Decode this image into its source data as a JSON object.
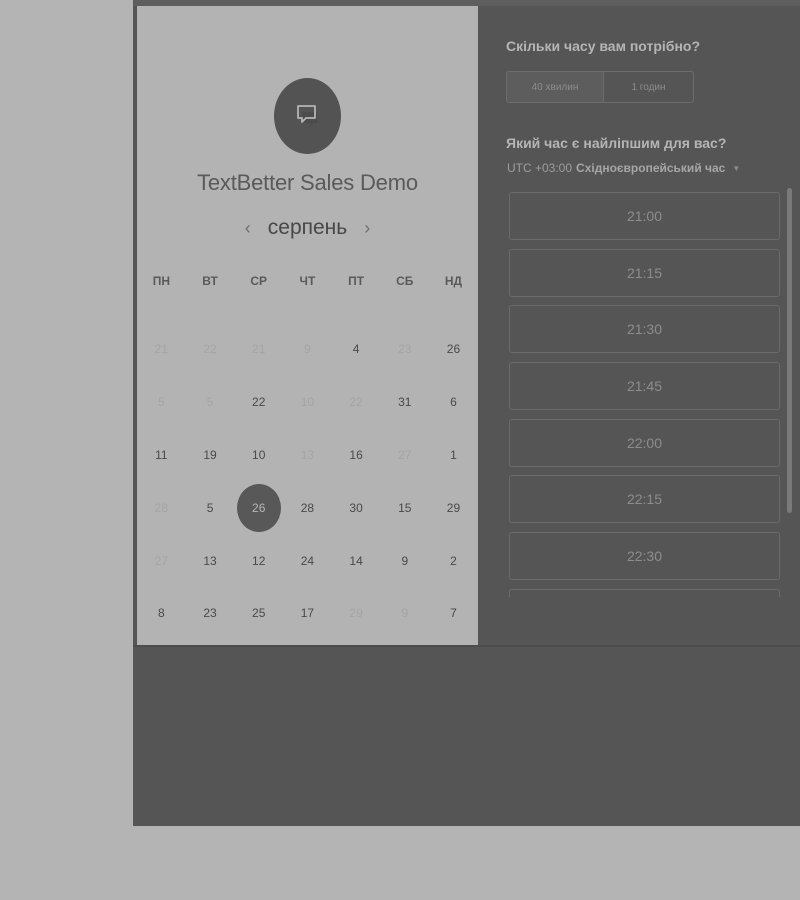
{
  "calendar": {
    "title": "TextBetter Sales Demo",
    "month": "серпень",
    "weekdays": [
      "ПН",
      "ВТ",
      "СР",
      "ЧТ",
      "ПТ",
      "СБ",
      "НД"
    ],
    "days": [
      {
        "label": "21",
        "muted": true
      },
      {
        "label": "22",
        "muted": true
      },
      {
        "label": "21",
        "muted": true
      },
      {
        "label": "9",
        "muted": true
      },
      {
        "label": "4",
        "muted": false
      },
      {
        "label": "23",
        "muted": true
      },
      {
        "label": "26",
        "muted": false
      },
      {
        "label": "5",
        "muted": true
      },
      {
        "label": "5",
        "muted": true
      },
      {
        "label": "22",
        "muted": false
      },
      {
        "label": "10",
        "muted": true
      },
      {
        "label": "22",
        "muted": true
      },
      {
        "label": "31",
        "muted": false
      },
      {
        "label": "6",
        "muted": false
      },
      {
        "label": "11",
        "muted": false
      },
      {
        "label": "19",
        "muted": false
      },
      {
        "label": "10",
        "muted": false
      },
      {
        "label": "13",
        "muted": true
      },
      {
        "label": "16",
        "muted": false
      },
      {
        "label": "27",
        "muted": true
      },
      {
        "label": "1",
        "muted": false
      },
      {
        "label": "28",
        "muted": true
      },
      {
        "label": "5",
        "muted": false
      },
      {
        "label": "26",
        "muted": false,
        "selected": true
      },
      {
        "label": "28",
        "muted": false
      },
      {
        "label": "30",
        "muted": false
      },
      {
        "label": "15",
        "muted": false
      },
      {
        "label": "29",
        "muted": false
      },
      {
        "label": "27",
        "muted": true
      },
      {
        "label": "13",
        "muted": false
      },
      {
        "label": "12",
        "muted": false
      },
      {
        "label": "24",
        "muted": false
      },
      {
        "label": "14",
        "muted": false
      },
      {
        "label": "9",
        "muted": false
      },
      {
        "label": "2",
        "muted": false
      },
      {
        "label": "8",
        "muted": false
      },
      {
        "label": "23",
        "muted": false
      },
      {
        "label": "25",
        "muted": false
      },
      {
        "label": "17",
        "muted": false
      },
      {
        "label": "29",
        "muted": true
      },
      {
        "label": "9",
        "muted": true
      },
      {
        "label": "7",
        "muted": false
      }
    ]
  },
  "booking": {
    "duration_question": "Скільки часу вам потрібно?",
    "durations": [
      "40 хвилин",
      "1 годин"
    ],
    "time_question": "Який час є найліпшим для вас?",
    "timezone_offset": "UTC +03:00",
    "timezone_name": "Східноєвропейський час",
    "slots": [
      "21:00",
      "21:15",
      "21:30",
      "21:45",
      "22:00",
      "22:15",
      "22:30",
      ""
    ]
  },
  "icons": {
    "logo": "chat-bubble-icon",
    "prev": "chevron-left-icon",
    "next": "chevron-right-icon",
    "tz_caret": "caret-down-icon"
  }
}
